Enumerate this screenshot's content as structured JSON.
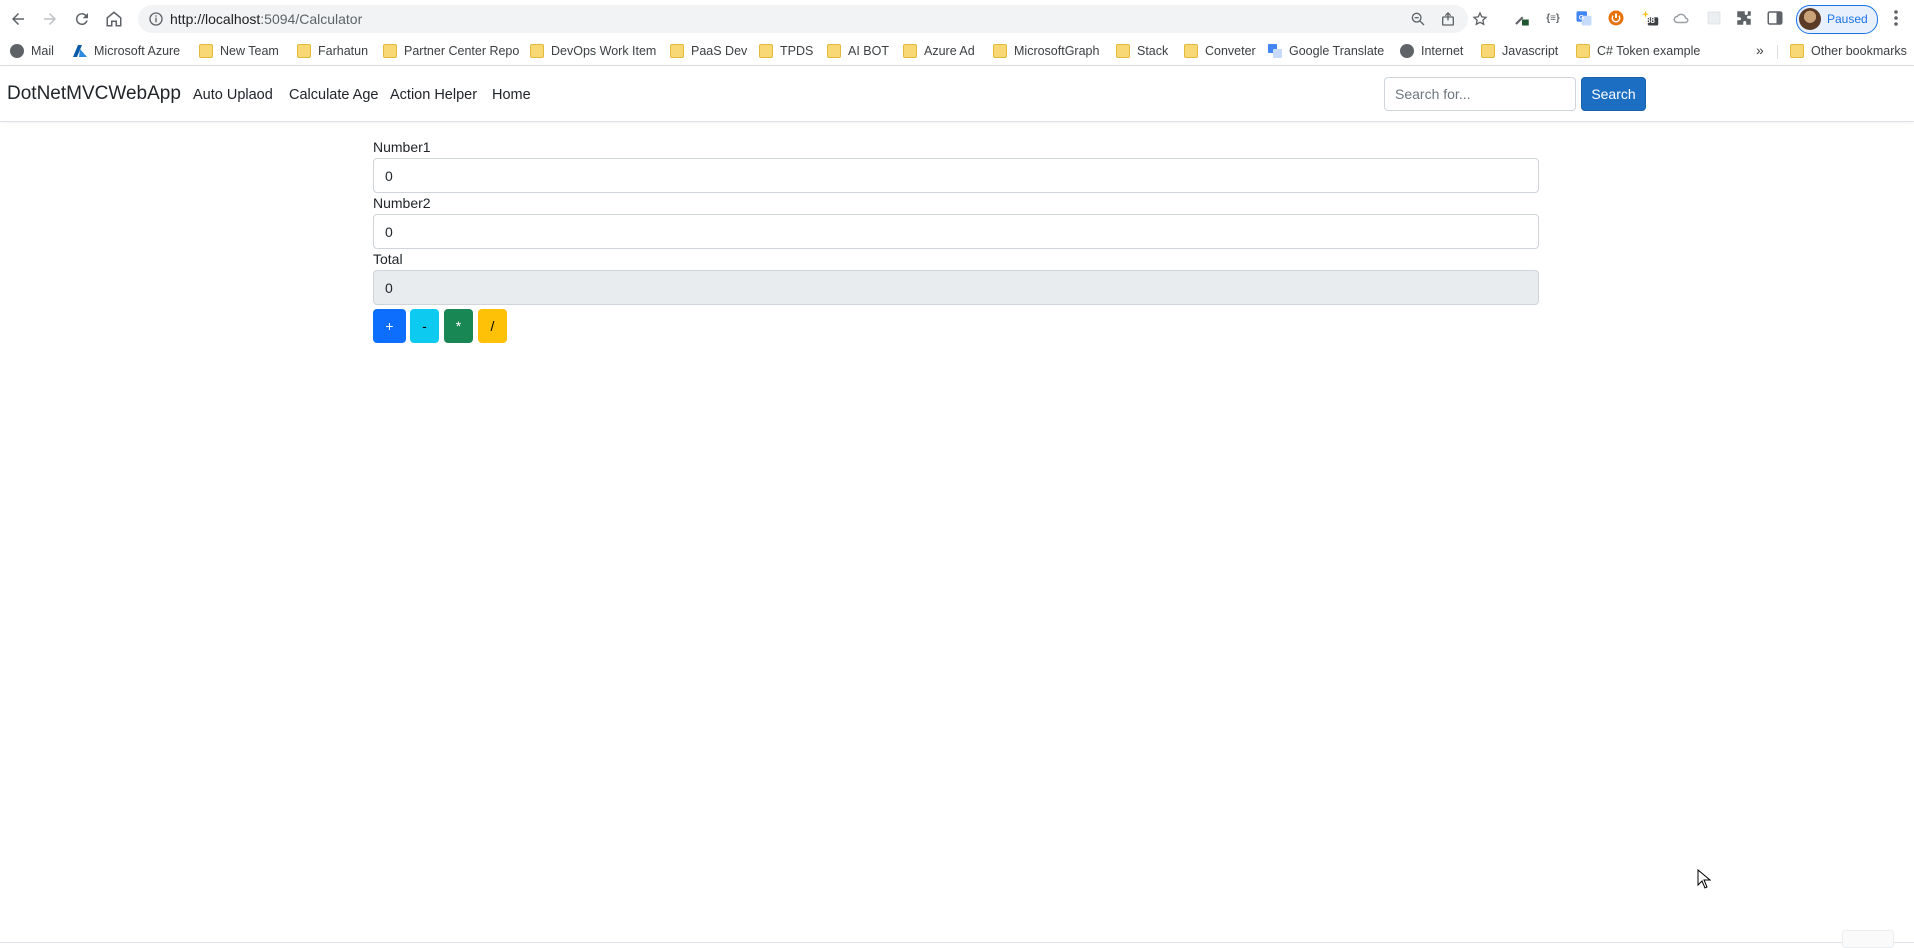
{
  "browser": {
    "url": "http://localhost:5094/Calculator",
    "url_host": "http://localhost",
    "url_rest": ":5094/Calculator",
    "profile_status": "Paused",
    "extension_badge": "88"
  },
  "bookmarks": [
    {
      "label": "Mail",
      "icon": "globe-icon"
    },
    {
      "label": "Microsoft Azure",
      "icon": "azure-icon"
    },
    {
      "label": "New Team",
      "icon": "folder-icon"
    },
    {
      "label": "Farhatun",
      "icon": "folder-icon"
    },
    {
      "label": "Partner Center Repo",
      "icon": "folder-icon"
    },
    {
      "label": "DevOps Work Item",
      "icon": "folder-icon"
    },
    {
      "label": "PaaS Dev",
      "icon": "folder-icon"
    },
    {
      "label": "TPDS",
      "icon": "folder-icon"
    },
    {
      "label": "AI BOT",
      "icon": "folder-icon"
    },
    {
      "label": "Azure Ad",
      "icon": "folder-icon"
    },
    {
      "label": "MicrosoftGraph",
      "icon": "folder-icon"
    },
    {
      "label": "Stack",
      "icon": "folder-icon"
    },
    {
      "label": "Conveter",
      "icon": "folder-icon"
    },
    {
      "label": "Google Translate",
      "icon": "translate-icon"
    },
    {
      "label": "Internet",
      "icon": "globe-icon"
    },
    {
      "label": "Javascript",
      "icon": "folder-icon"
    },
    {
      "label": "C# Token example",
      "icon": "folder-icon"
    }
  ],
  "bookmarks_overflow": "»",
  "other_bookmarks": "Other bookmarks",
  "navbar": {
    "brand": "DotNetMVCWebApp",
    "links": [
      "Auto Uplaod",
      "Calculate Age",
      "Action Helper",
      "Home"
    ],
    "search_placeholder": "Search for...",
    "search_button": "Search"
  },
  "calculator": {
    "number1_label": "Number1",
    "number1_value": "0",
    "number2_label": "Number2",
    "number2_value": "0",
    "total_label": "Total",
    "total_value": "0",
    "buttons": {
      "add": "+",
      "subtract": "-",
      "multiply": "*",
      "divide": "/"
    }
  },
  "colors": {
    "primary": "#0d6efd",
    "info": "#0dcaf0",
    "success": "#198754",
    "warning": "#ffc107",
    "search_button": "#1b6ec2"
  }
}
